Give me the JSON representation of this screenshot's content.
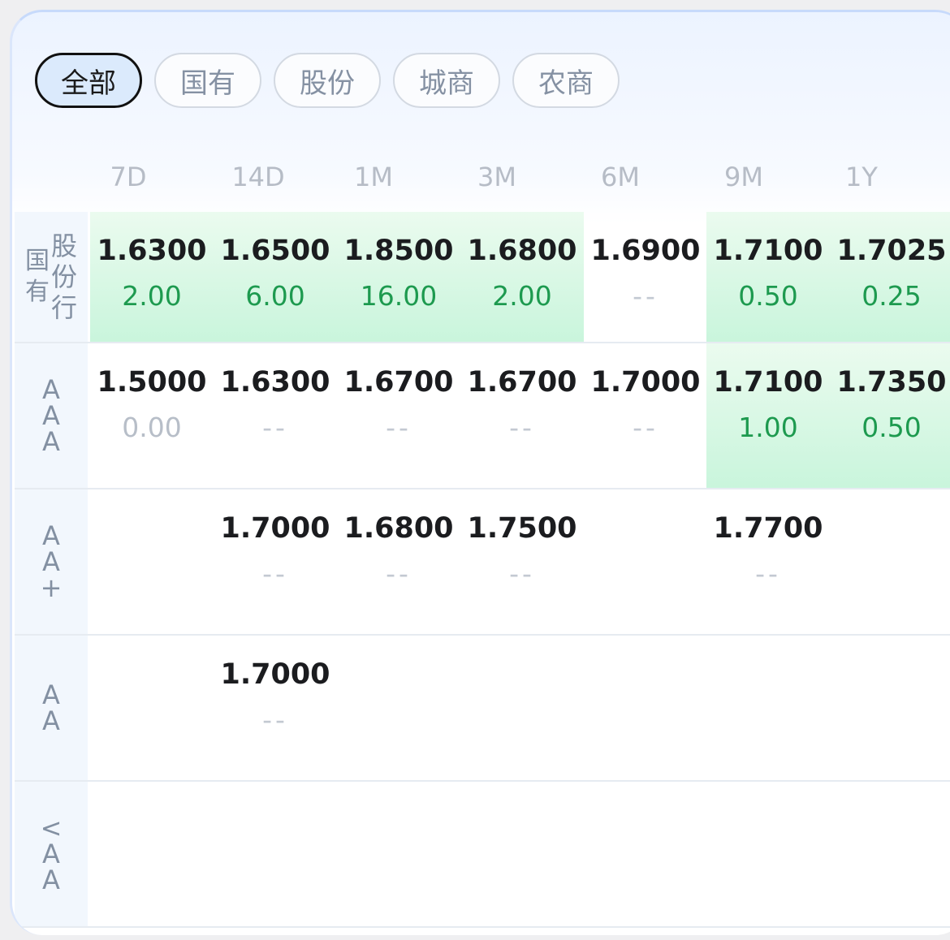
{
  "filters": [
    {
      "label": "全部",
      "active": true
    },
    {
      "label": "国有",
      "active": false
    },
    {
      "label": "股份",
      "active": false
    },
    {
      "label": "城商",
      "active": false
    },
    {
      "label": "农商",
      "active": false
    }
  ],
  "columns": [
    "7D",
    "14D",
    "1M",
    "3M",
    "6M",
    "9M",
    "1Y"
  ],
  "rows": [
    {
      "label_left": "国有",
      "label_right": "股份行",
      "cells": [
        {
          "price": "1.6300",
          "volume": "2.00",
          "highlight": true
        },
        {
          "price": "1.6500",
          "volume": "6.00",
          "highlight": true
        },
        {
          "price": "1.8500",
          "volume": "16.00",
          "highlight": true
        },
        {
          "price": "1.6800",
          "volume": "2.00",
          "highlight": true
        },
        {
          "price": "1.6900",
          "volume": "--",
          "highlight": false
        },
        {
          "price": "1.7100",
          "volume": "0.50",
          "highlight": true
        },
        {
          "price": "1.7025",
          "volume": "0.25",
          "highlight": true
        }
      ]
    },
    {
      "label": "AAA",
      "cells": [
        {
          "price": "1.5000",
          "volume": "0.00",
          "highlight": false
        },
        {
          "price": "1.6300",
          "volume": "--",
          "highlight": false
        },
        {
          "price": "1.6700",
          "volume": "--",
          "highlight": false
        },
        {
          "price": "1.6700",
          "volume": "--",
          "highlight": false
        },
        {
          "price": "1.7000",
          "volume": "--",
          "highlight": false
        },
        {
          "price": "1.7100",
          "volume": "1.00",
          "highlight": true
        },
        {
          "price": "1.7350",
          "volume": "0.50",
          "highlight": true
        }
      ]
    },
    {
      "label": "AA+",
      "cells": [
        {
          "price": "",
          "volume": "",
          "highlight": false
        },
        {
          "price": "1.7000",
          "volume": "--",
          "highlight": false
        },
        {
          "price": "1.6800",
          "volume": "--",
          "highlight": false
        },
        {
          "price": "1.7500",
          "volume": "--",
          "highlight": false
        },
        {
          "price": "",
          "volume": "",
          "highlight": false
        },
        {
          "price": "1.7700",
          "volume": "--",
          "highlight": false
        },
        {
          "price": "",
          "volume": "",
          "highlight": false
        }
      ]
    },
    {
      "label": "AA",
      "cells": [
        {
          "price": "",
          "volume": "",
          "highlight": false
        },
        {
          "price": "1.7000",
          "volume": "--",
          "highlight": false
        },
        {
          "price": "",
          "volume": "",
          "highlight": false
        },
        {
          "price": "",
          "volume": "",
          "highlight": false
        },
        {
          "price": "",
          "volume": "",
          "highlight": false
        },
        {
          "price": "",
          "volume": "",
          "highlight": false
        },
        {
          "price": "",
          "volume": "",
          "highlight": false
        }
      ]
    },
    {
      "label": "<AA",
      "cells": [
        {
          "price": "",
          "volume": "",
          "highlight": false
        },
        {
          "price": "",
          "volume": "",
          "highlight": false
        },
        {
          "price": "",
          "volume": "",
          "highlight": false
        },
        {
          "price": "",
          "volume": "",
          "highlight": false
        },
        {
          "price": "",
          "volume": "",
          "highlight": false
        },
        {
          "price": "",
          "volume": "",
          "highlight": false
        },
        {
          "price": "",
          "volume": "",
          "highlight": false
        }
      ]
    }
  ],
  "colors": {
    "up_green": "#1d9a4f",
    "highlight": "#c9f5dc",
    "active_chip": "#dbeafc"
  }
}
